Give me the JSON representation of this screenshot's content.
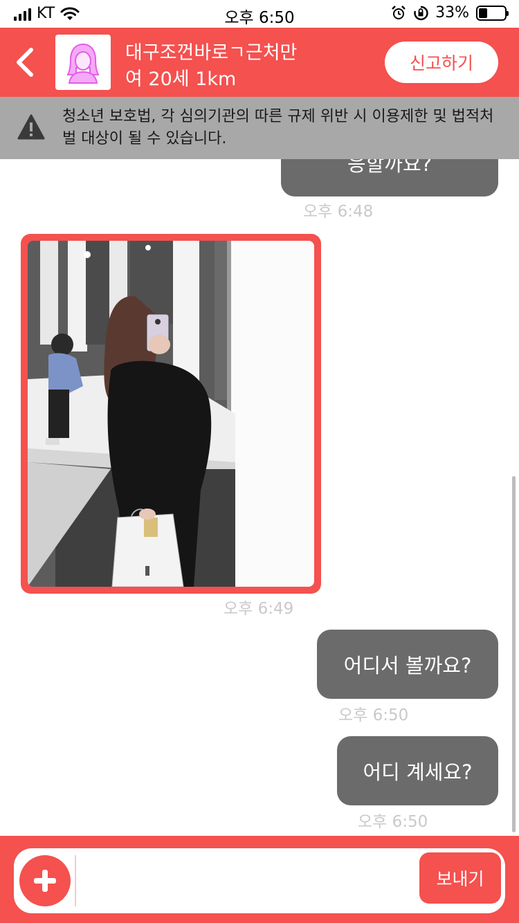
{
  "status_bar": {
    "carrier": "KT",
    "time": "오후 6:50",
    "battery_percent": "33%",
    "battery_level": 0.33
  },
  "header": {
    "back_icon": "chevron-left-icon",
    "avatar_icon": "female-profile-icon",
    "name": "대구조껀바로ㄱ근처만",
    "subtitle": "여 20세 1km",
    "report_label": "신고하기"
  },
  "warning": {
    "icon": "warning-triangle-icon",
    "text": "청소년 보호법, 각 심의기관의 따른 규제 위반 시 이용제한 및 법적처벌 대상이 될 수 있습니다."
  },
  "messages": [
    {
      "text": "응할까요?",
      "time": "오후 6:48"
    },
    {
      "type": "image",
      "time": "오후 6:49"
    },
    {
      "text": "어디서 볼까요?",
      "time": "오후 6:50"
    },
    {
      "text": "어디 계세요?",
      "time": "오후 6:50"
    }
  ],
  "input_bar": {
    "plus_icon": "plus-icon",
    "placeholder": "",
    "send_label": "보내기"
  },
  "colors": {
    "accent": "#f4514f",
    "bubble": "#6b6b6b",
    "warning_bg": "#a8a8a8",
    "timestamp": "#c9c9c9"
  }
}
